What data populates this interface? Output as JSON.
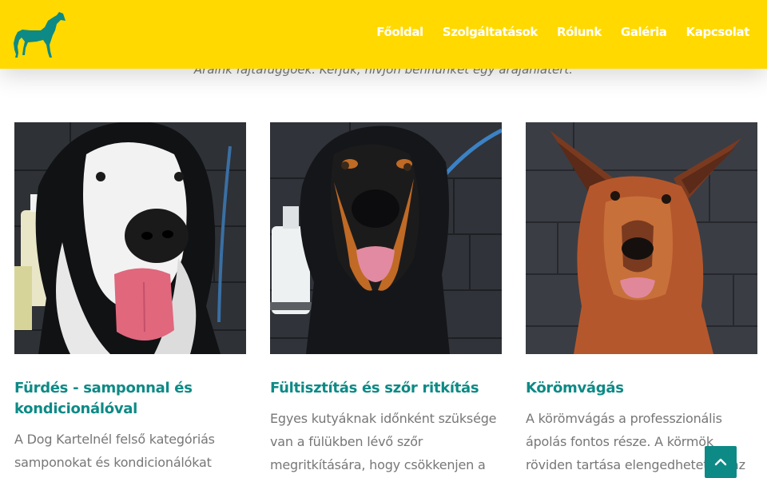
{
  "nav": {
    "items": [
      "Főoldal",
      "Szolgáltatások",
      "Rólunk",
      "Galéria",
      "Kapcsolat"
    ]
  },
  "intro_text": "Áraink fajtafüggőek. Kérjük, hívjon bennünket egy árajánlatért.",
  "cards": [
    {
      "title": "Fürdés - samponnal és kondicionálóval",
      "text": "A Dog Kartelnél felső kategóriás samponokat és kondicionálókat"
    },
    {
      "title": "Fültisztítás és szőr ritkítás",
      "text": "Egyes kutyáknak időnként szüksége van a fülükben lévő szőr megritkítására, hogy csökkenjen a"
    },
    {
      "title": "Körömvágás",
      "text": "A körömvágás a professzionális ápolás fontos része. A körmök röviden tartása elengedhetetlen az"
    }
  ],
  "colors": {
    "header_bg": "#ffd900",
    "accent": "#0d8a86",
    "nav_text": "#ffffff",
    "body_text": "#777777"
  },
  "icons": {
    "logo": "greyhound-logo",
    "scroll_top": "chevron-up-icon"
  }
}
